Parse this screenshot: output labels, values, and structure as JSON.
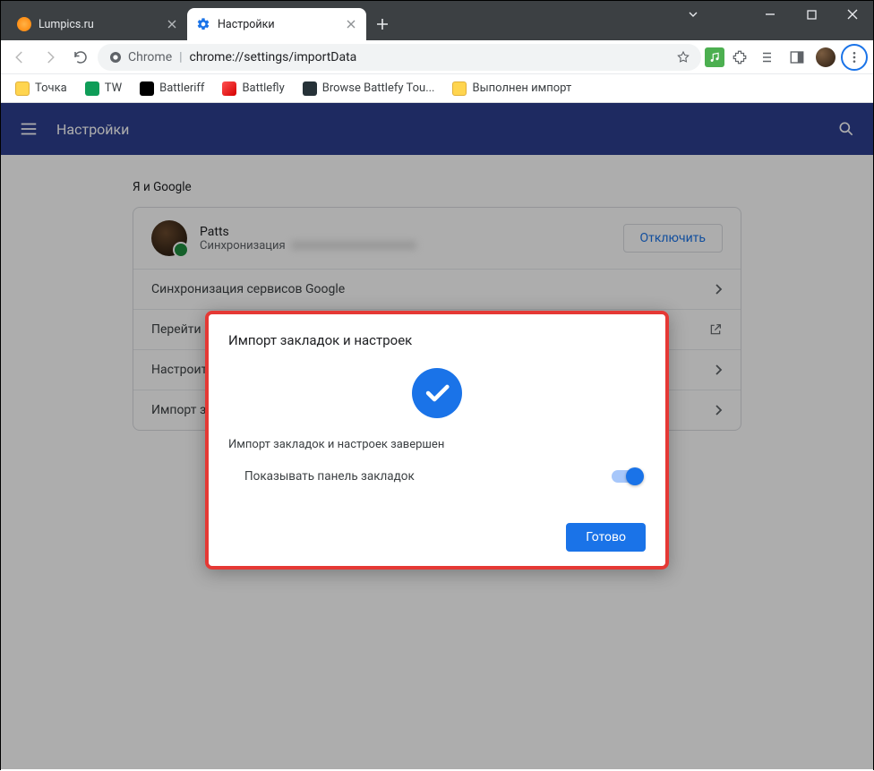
{
  "window": {
    "tabs": [
      {
        "title": "Lumpics.ru",
        "active": false
      },
      {
        "title": "Настройки",
        "active": true
      }
    ]
  },
  "omnibox": {
    "scheme_label": "Chrome",
    "url": "chrome://settings/importData"
  },
  "bookmarks": [
    {
      "label": "Точка"
    },
    {
      "label": "TW"
    },
    {
      "label": "Battleriff"
    },
    {
      "label": "Battlefly"
    },
    {
      "label": "Browse Battlefy Tou..."
    },
    {
      "label": "Выполнен импорт"
    }
  ],
  "settings_header": {
    "title": "Настройки"
  },
  "section": {
    "title": "Я и Google"
  },
  "profile": {
    "name": "Patts",
    "sync_label": "Синхронизация",
    "disconnect": "Отключить"
  },
  "rows": {
    "sync_services": "Синхронизация сервисов Google",
    "go_to": "Перейти в",
    "customize": "Настроить",
    "import": "Импорт за"
  },
  "dialog": {
    "title": "Импорт закладок и настроек",
    "message": "Импорт закладок и настроек завершен",
    "toggle_label": "Показывать панель закладок",
    "done": "Готово"
  }
}
